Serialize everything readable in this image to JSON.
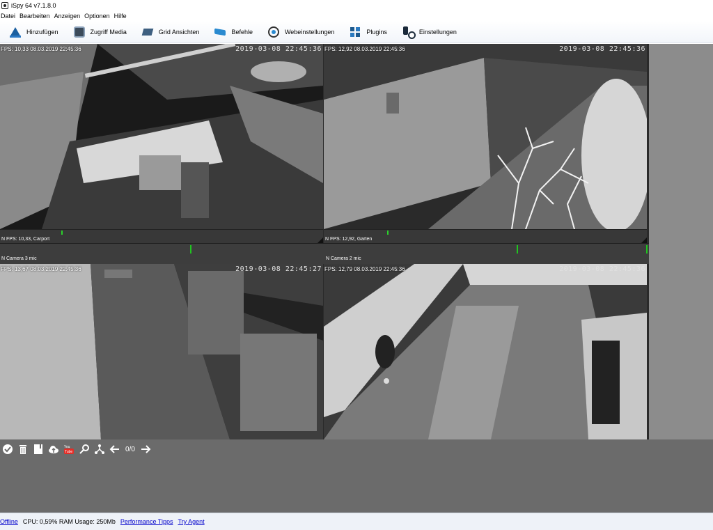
{
  "window": {
    "title": "iSpy 64 v7.1.8.0"
  },
  "menu": [
    "Datei",
    "Bearbeiten",
    "Anzeigen",
    "Optionen",
    "Hilfe"
  ],
  "toolbar": {
    "add": "Hinzufügen",
    "media": "Zugriff Media",
    "grid": "Grid Ansichten",
    "commands": "Befehle",
    "web": "Webeinstellungen",
    "plugins": "Plugins",
    "settings": "Einstellungen"
  },
  "cameras": [
    {
      "overlay_left": "FPS: 10,33 08.03.2019 22:45:36",
      "timestamp": "2019-03-08  22:45:36",
      "label": "N  FPS: 10,33, Carport"
    },
    {
      "overlay_left": "FPS: 12,92 08.03.2019 22:45:36",
      "timestamp": "2019-03-08  22:45:36",
      "label": "N  FPS: 12,92, Garten"
    },
    {
      "overlay_left": "FPS: 13,67 08.03.2019 22:45:36",
      "timestamp": "2019-03-08  22:45:27"
    },
    {
      "overlay_left": "FPS: 12,79 08.03.2019 22:45:36",
      "timestamp": "2019-03-08  22:45:36"
    }
  ],
  "mics": [
    {
      "label": "N  Camera 3 mic"
    },
    {
      "label": "N  Camera 2 mic"
    }
  ],
  "controls": {
    "icons": [
      "check-icon",
      "trash-icon",
      "book-icon",
      "cloud-upload-icon",
      "youtube-icon",
      "search-icon",
      "share-icon",
      "arrow-left-icon",
      "arrow-right-icon"
    ],
    "page_count": "0/0"
  },
  "status": {
    "offline": "Offline",
    "cpu": "CPU: 0,59% RAM Usage: 250Mb",
    "perf": "Performance Tipps",
    "agent": "Try Agent"
  }
}
